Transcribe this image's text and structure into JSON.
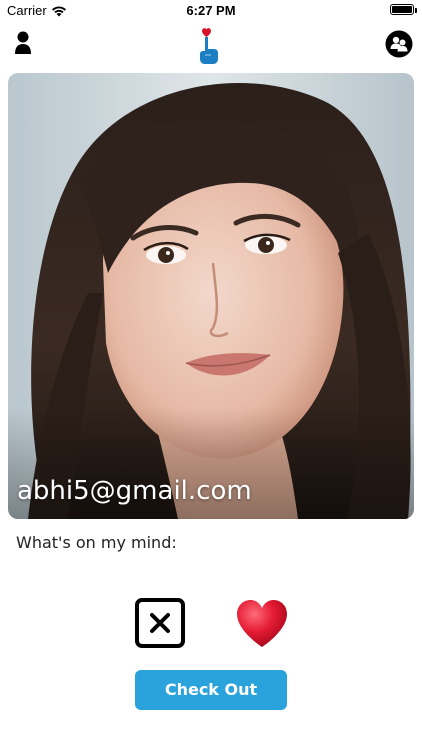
{
  "status_bar": {
    "carrier": "Carrier",
    "time": "6:27 PM",
    "battery_level": 1.0
  },
  "nav": {
    "left_icon": "profile-icon",
    "center_logo": "heart-hand-logo",
    "right_icon": "matches-icon"
  },
  "card": {
    "email": "abhi5@gmail.com",
    "photo": "profile-photo"
  },
  "mind_label": "What's on my mind:",
  "actions": {
    "reject_icon": "close-icon",
    "like_icon": "heart-icon"
  },
  "checkout_label": "Check Out",
  "colors": {
    "accent": "#2aa3dc",
    "logo_blue": "#1c7fc4",
    "heart_red": "#d8102a"
  }
}
